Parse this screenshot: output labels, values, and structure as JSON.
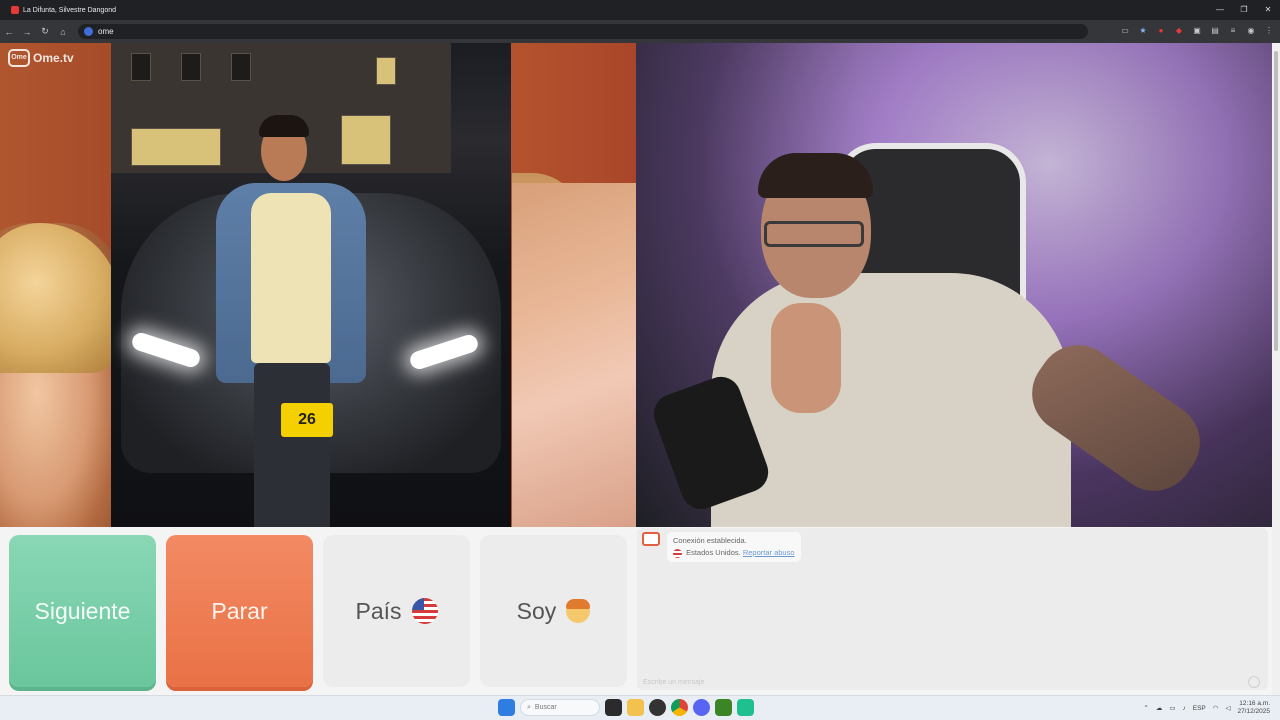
{
  "browser": {
    "tab_title": "La Difunta, Silvestre Dangond",
    "url_text": "ome",
    "window_controls": [
      "—",
      "❐",
      "✕"
    ]
  },
  "app": {
    "logo_text": "Ome.tv",
    "logo_box_text": "Ome"
  },
  "overlay_photo": {
    "plate_text": "26"
  },
  "controls": {
    "next_label": "Siguiente",
    "stop_label": "Parar",
    "country_label": "País",
    "country_flag_icon": "us-flag-icon",
    "soy_label": "Soy",
    "soy_icon": "boy-emoji-icon"
  },
  "chat": {
    "connected_text": "Conexión establecida.",
    "country_text": "Estados Unidos.",
    "report_link": "Reportar abuso",
    "input_placeholder": "Escribe un mensaje"
  },
  "taskbar": {
    "search_placeholder": "Buscar",
    "language": "ESP",
    "time": "12:16 a.m.",
    "date": "27/12/2025"
  },
  "colors": {
    "next_button": "#6ac69d",
    "stop_button": "#ea7146",
    "neutral_button": "#ececec"
  }
}
